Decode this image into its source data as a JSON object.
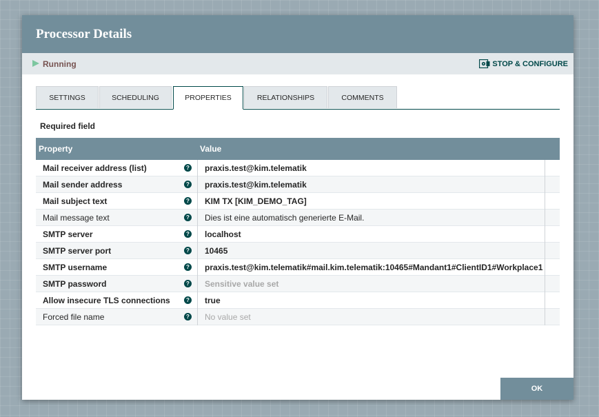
{
  "dialog": {
    "title": "Processor Details"
  },
  "status": {
    "label": "Running",
    "stop_configure_label": "STOP & CONFIGURE"
  },
  "tabs": [
    {
      "label": "SETTINGS"
    },
    {
      "label": "SCHEDULING"
    },
    {
      "label": "PROPERTIES",
      "active": true
    },
    {
      "label": "RELATIONSHIPS"
    },
    {
      "label": "COMMENTS"
    }
  ],
  "required_field_label": "Required field",
  "table": {
    "headers": {
      "property": "Property",
      "value": "Value"
    },
    "rows": [
      {
        "name": "Mail receiver address (list)",
        "value": "praxis.test@kim.telematik",
        "required": true
      },
      {
        "name": "Mail sender address",
        "value": "praxis.test@kim.telematik",
        "required": true
      },
      {
        "name": "Mail subject text",
        "value": "KIM TX [KIM_DEMO_TAG]",
        "required": true
      },
      {
        "name": "Mail message text",
        "value": "Dies ist eine automatisch generierte E-Mail.",
        "required": false
      },
      {
        "name": "SMTP server",
        "value": "localhost",
        "required": true
      },
      {
        "name": "SMTP server port",
        "value": "10465",
        "required": true
      },
      {
        "name": "SMTP username",
        "value": "praxis.test@kim.telematik#mail.kim.telematik:10465#Mandant1#ClientID1#Workplace1",
        "required": true
      },
      {
        "name": "SMTP password",
        "value": "Sensitive value set",
        "required": true,
        "muted": true
      },
      {
        "name": "Allow insecure TLS connections",
        "value": "true",
        "required": true
      },
      {
        "name": "Forced file name",
        "value": "No value set",
        "required": false,
        "muted": true
      }
    ]
  },
  "footer": {
    "ok_label": "OK"
  },
  "colors": {
    "header": "#728e9b",
    "accent": "#004849",
    "running": "#7dc7a0"
  },
  "icons": {
    "running": "play-icon",
    "stop_configure": "stop-configure-icon",
    "help": "help-icon"
  }
}
